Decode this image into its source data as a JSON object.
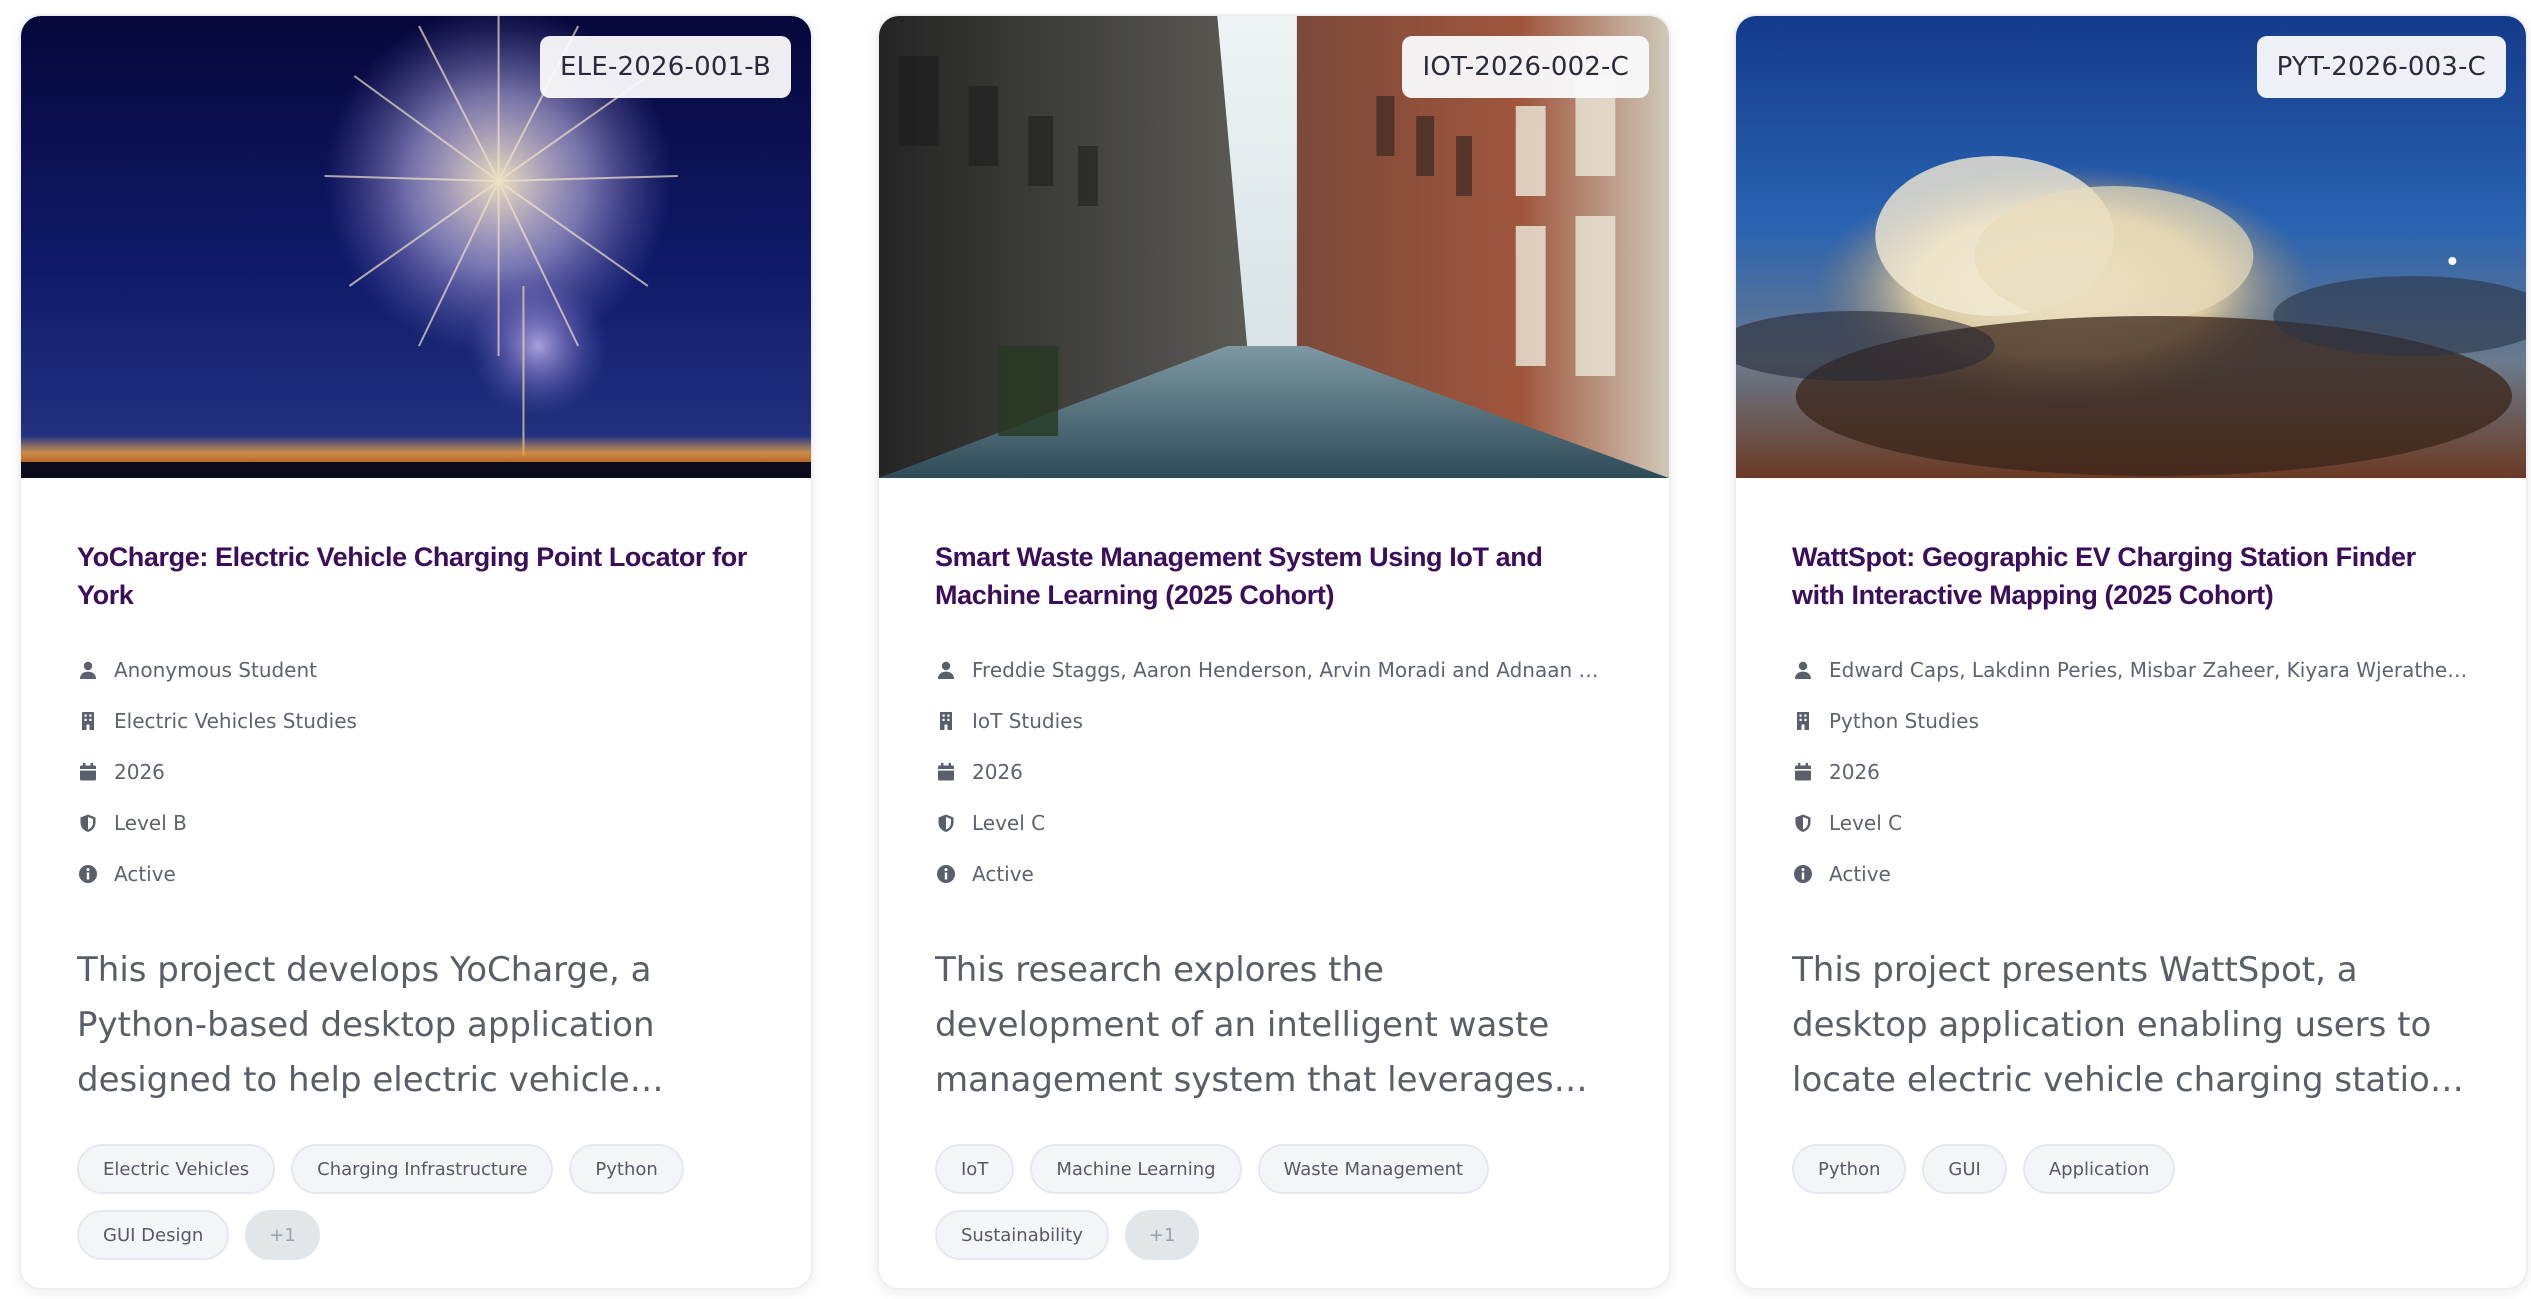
{
  "cards": [
    {
      "code": "ELE-2026-001-B",
      "title": "YoCharge: Electric Vehicle Charging Point Locator for York",
      "author": "Anonymous Student",
      "studies": "Electric Vehicles Studies",
      "year": "2026",
      "level": "Level B",
      "status": "Active",
      "description": "This project develops YoCharge, a Python-based desktop application designed to help electric vehicle users...",
      "tags": [
        "Electric Vehicles",
        "Charging Infrastructure",
        "Python",
        "GUI Design"
      ],
      "more": "+1",
      "image": "fireworks-night-sky"
    },
    {
      "code": "IOT-2026-002-C",
      "title": "Smart Waste Management System Using IoT and Machine Learning (2025 Cohort)",
      "author": "Freddie Staggs, Aaron Henderson, Arvin Moradi and Adnaan Munaw...",
      "studies": "IoT Studies",
      "year": "2026",
      "level": "Level C",
      "status": "Active",
      "description": "This research explores the development of an intelligent waste management system that leverages Internet of Things...",
      "tags": [
        "IoT",
        "Machine Learning",
        "Waste Management",
        "Sustainability"
      ],
      "more": "+1",
      "image": "city-street"
    },
    {
      "code": "PYT-2026-003-C",
      "title": "WattSpot: Geographic EV Charging Station Finder with Interactive Mapping (2025 Cohort)",
      "author": "Edward Caps, Lakdinn Peries, Misbar Zaheer, Kiyara Wjerathe and Jo...",
      "studies": "Python Studies",
      "year": "2026",
      "level": "Level C",
      "status": "Active",
      "description": "This project presents WattSpot, a desktop application enabling users to locate electric vehicle charging stations throug...",
      "tags": [
        "Python",
        "GUI",
        "Application"
      ],
      "more": "",
      "image": "storm-cloud-sky"
    }
  ],
  "icons": {
    "author": "user-icon",
    "studies": "building-icon",
    "year": "calendar-icon",
    "level": "shield-icon",
    "status": "info-icon"
  },
  "colors": {
    "title": "#3b0d5a",
    "meta_text": "#5f6370",
    "icon": "#5a5f6b",
    "tag_bg": "#f4f5f8",
    "more_bg": "#e2e6e8"
  }
}
